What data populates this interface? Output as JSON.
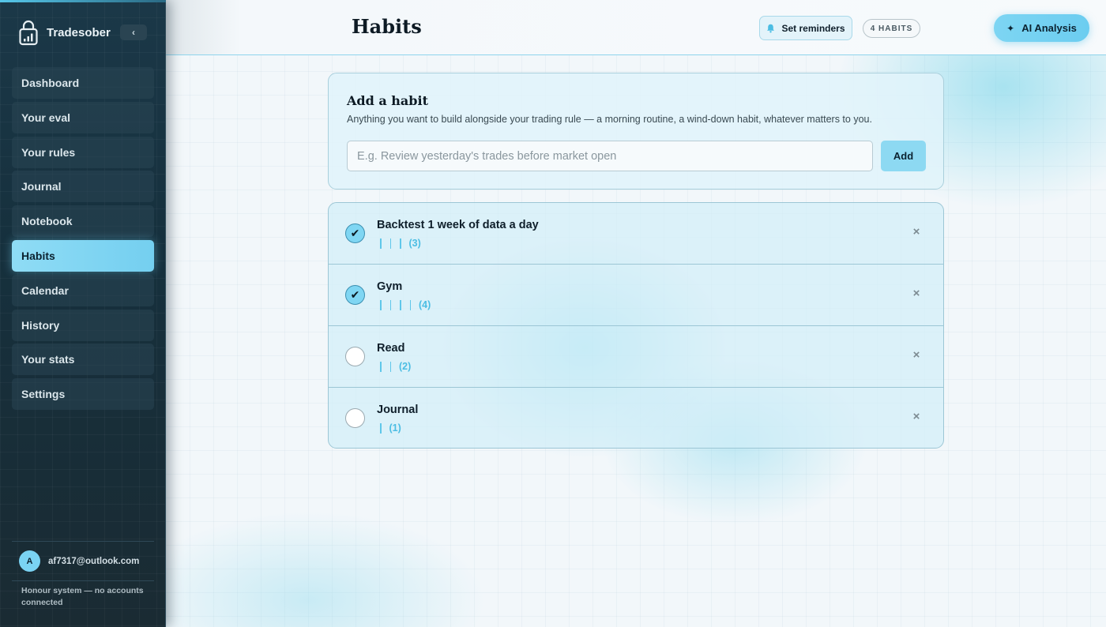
{
  "app": {
    "name": "Tradesober",
    "collapse_glyph": "‹"
  },
  "sidebar": {
    "items": [
      {
        "label": "Dashboard",
        "active": false
      },
      {
        "label": "Your eval",
        "active": false
      },
      {
        "label": "Your rules",
        "active": false
      },
      {
        "label": "Journal",
        "active": false
      },
      {
        "label": "Notebook",
        "active": false
      },
      {
        "label": "Habits",
        "active": true
      },
      {
        "label": "Calendar",
        "active": false
      },
      {
        "label": "History",
        "active": false
      },
      {
        "label": "Your stats",
        "active": false
      },
      {
        "label": "Settings",
        "active": false
      }
    ],
    "user": {
      "avatar_initial": "A",
      "email": "af7317@outlook.com"
    },
    "honour_note": "Honour system — no accounts connected"
  },
  "header": {
    "title": "Habits",
    "reminders_label": "Set reminders",
    "habit_count_badge": "4 HABITS",
    "ai_label": "AI Analysis",
    "ai_icon_glyph": "✦"
  },
  "add_habit": {
    "title": "Add a habit",
    "description": "Anything you want to build alongside your trading rule — a morning routine, a wind-down habit, whatever matters to you.",
    "input_value": "",
    "placeholder": "E.g. Review yesterday's trades before market open",
    "button_label": "Add"
  },
  "habits": [
    {
      "name": "Backtest 1 week of data a day",
      "done": true,
      "tally": 3,
      "count_label": "(3)"
    },
    {
      "name": "Gym",
      "done": true,
      "tally": 4,
      "count_label": "(4)"
    },
    {
      "name": "Read",
      "done": false,
      "tally": 2,
      "count_label": "(2)"
    },
    {
      "name": "Journal",
      "done": false,
      "tally": 1,
      "count_label": "(1)"
    }
  ],
  "glyphs": {
    "check": "✔",
    "delete": "×"
  },
  "icons": {
    "logo": "lock-chart-icon",
    "bell": "bell-icon",
    "sparkle": "sparkle-icon"
  },
  "colors": {
    "accent": "#7dd5f3",
    "sidebar_bg": "#1b3848",
    "tally": "#5fc7ea"
  }
}
